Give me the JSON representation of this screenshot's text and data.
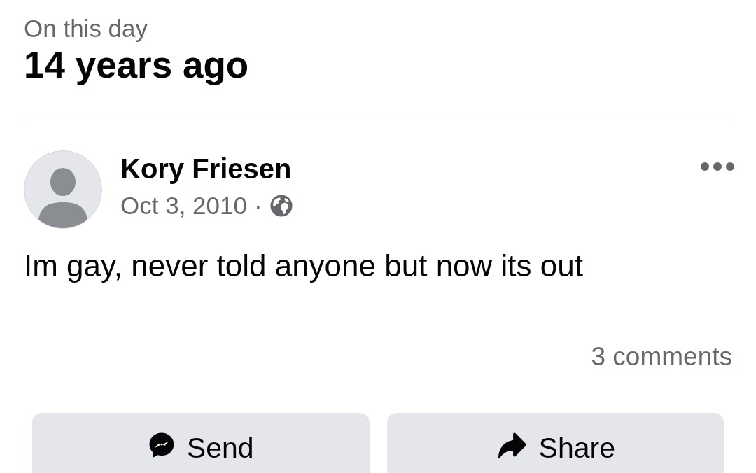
{
  "header": {
    "caption": "On this day",
    "title": "14 years ago"
  },
  "post": {
    "author": "Kory Friesen",
    "date": "Oct 3, 2010",
    "separator": "·",
    "text": "Im gay, never told anyone but now its out",
    "comment_count": "3 comments"
  },
  "actions": [
    {
      "kind": "send",
      "label": "Send"
    },
    {
      "kind": "share",
      "label": "Share"
    }
  ]
}
